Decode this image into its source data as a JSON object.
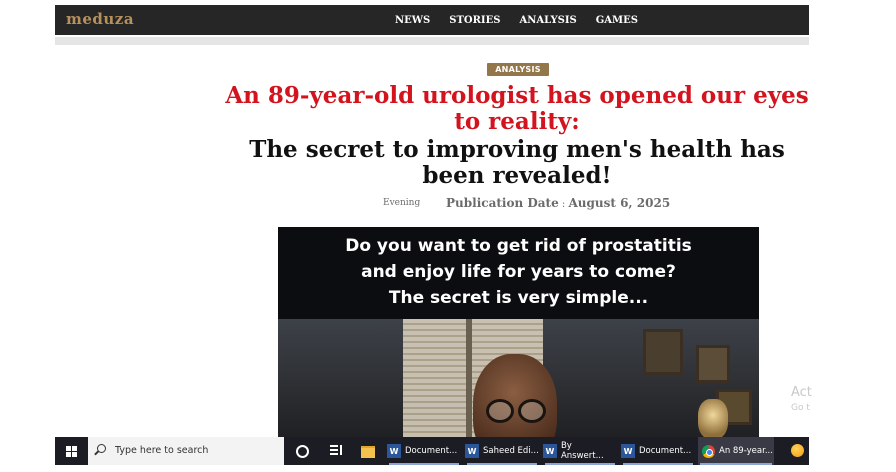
{
  "site": {
    "logo": "meduza"
  },
  "nav": {
    "items": [
      "NEWS",
      "STORIES",
      "ANALYSIS",
      "GAMES"
    ]
  },
  "article": {
    "badge": "ANALYSIS",
    "headline_red": "An 89-year-old urologist has opened our eyes to reality:",
    "headline_black": "The secret to improving men's health has been revealed!",
    "author": "Evening",
    "pub_label": "Publication Date",
    "pub_sep": " : ",
    "pub_date": "August 6, 2025",
    "hero_lines": [
      "Do you want to get rid of prostatitis",
      "and enjoy life for years to come?",
      "The secret is very simple..."
    ]
  },
  "watermark": {
    "line1": "Act",
    "line2": "Go t"
  },
  "taskbar": {
    "search_placeholder": "Type here to search",
    "items": [
      {
        "icon": "word-icon",
        "label": "Document..."
      },
      {
        "icon": "word-icon",
        "label": "Saheed Edi..."
      },
      {
        "icon": "word-icon",
        "label": "By Answert..."
      },
      {
        "icon": "word-icon",
        "label": "Document..."
      },
      {
        "icon": "chrome-icon",
        "label": "An 89-year..."
      }
    ]
  },
  "colors": {
    "accent_red": "#d3141f",
    "badge_brown": "#94764b",
    "nav_bg": "#262626"
  }
}
